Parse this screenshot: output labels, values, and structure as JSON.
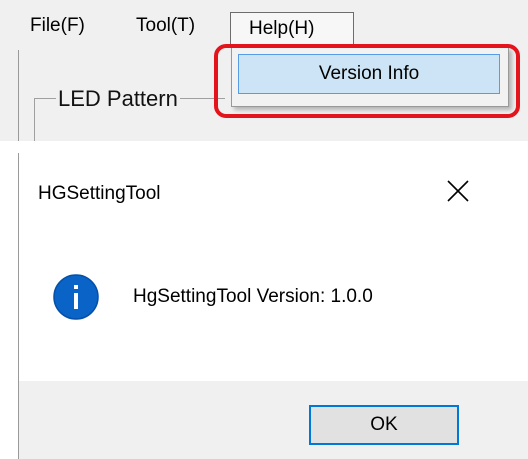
{
  "menubar": {
    "file_label": "File(F)",
    "tool_label": "Tool(T)",
    "help_label": "Help(H)"
  },
  "help_menu": {
    "items": [
      {
        "label": "Version Info",
        "icon": "none"
      }
    ]
  },
  "background_form": {
    "group_label": "LED Pattern"
  },
  "message_box": {
    "title": "HGSettingTool",
    "close_icon": "close-icon",
    "icon": "info-icon",
    "message": "HgSettingTool Version: 1.0.0",
    "ok_label": "OK"
  },
  "colors": {
    "highlight": "#e3141b",
    "menu_hover": "#cde4f7",
    "menu_hover_border": "#569de5",
    "info_icon": "#0a64c8",
    "ok_focus_border": "#0078d7"
  }
}
